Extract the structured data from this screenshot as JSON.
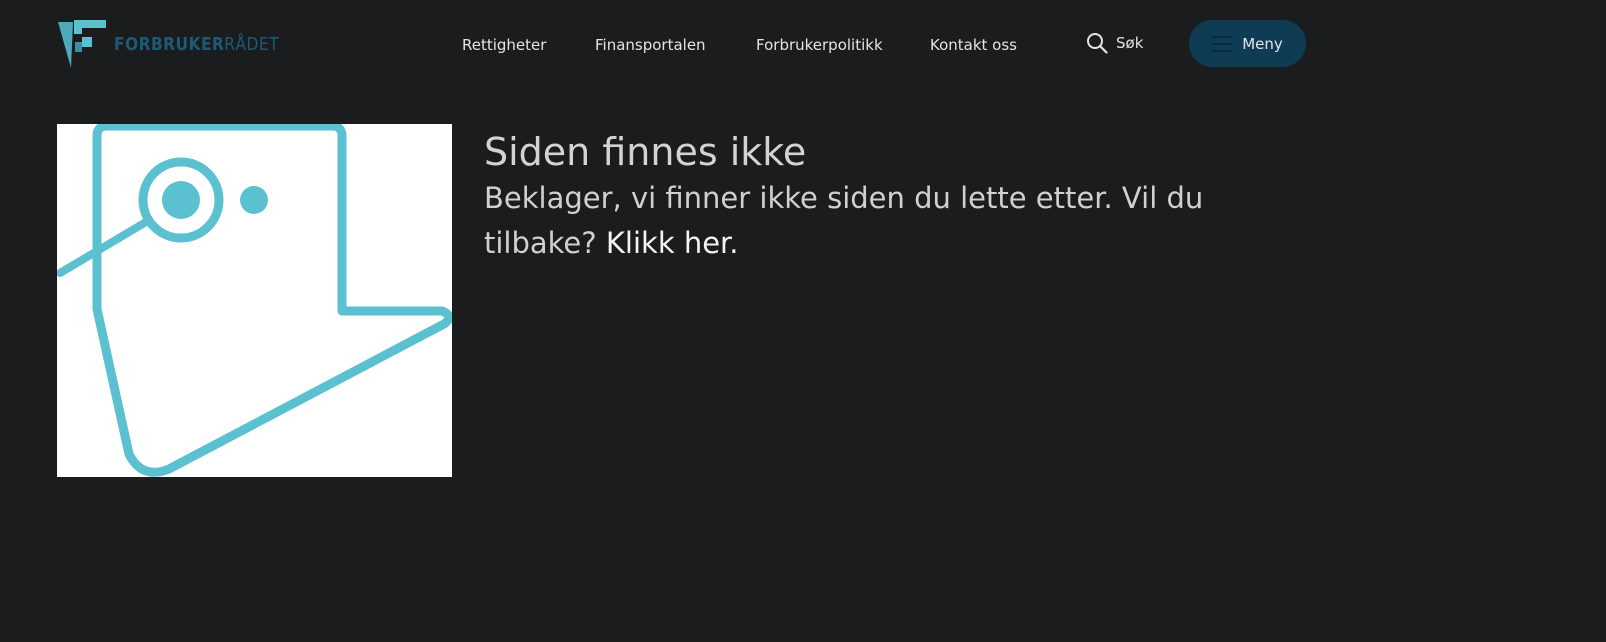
{
  "brand": {
    "name_bold": "FORBRUKER",
    "name_light": "RÅDET",
    "accent": "#5bc0d0",
    "dark_accent": "#1d5a78"
  },
  "nav": {
    "items": [
      {
        "label": "Rettigheter"
      },
      {
        "label": "Finansportalen"
      },
      {
        "label": "Forbrukerpolitikk"
      },
      {
        "label": "Kontakt oss"
      }
    ],
    "search_label": "Søk",
    "search_icon": "search-icon",
    "menu_label": "Meny",
    "menu_icon": "hamburger-icon",
    "menu_bg": "#0e3c55"
  },
  "main": {
    "title": "Siden finnes ikke",
    "message": "Beklager, vi finner ikke siden du lette etter. Vil du tilbake?",
    "link_label": "Klikk her."
  },
  "colors": {
    "page_bg": "#1b1c1e",
    "text": "#d8d9db"
  }
}
